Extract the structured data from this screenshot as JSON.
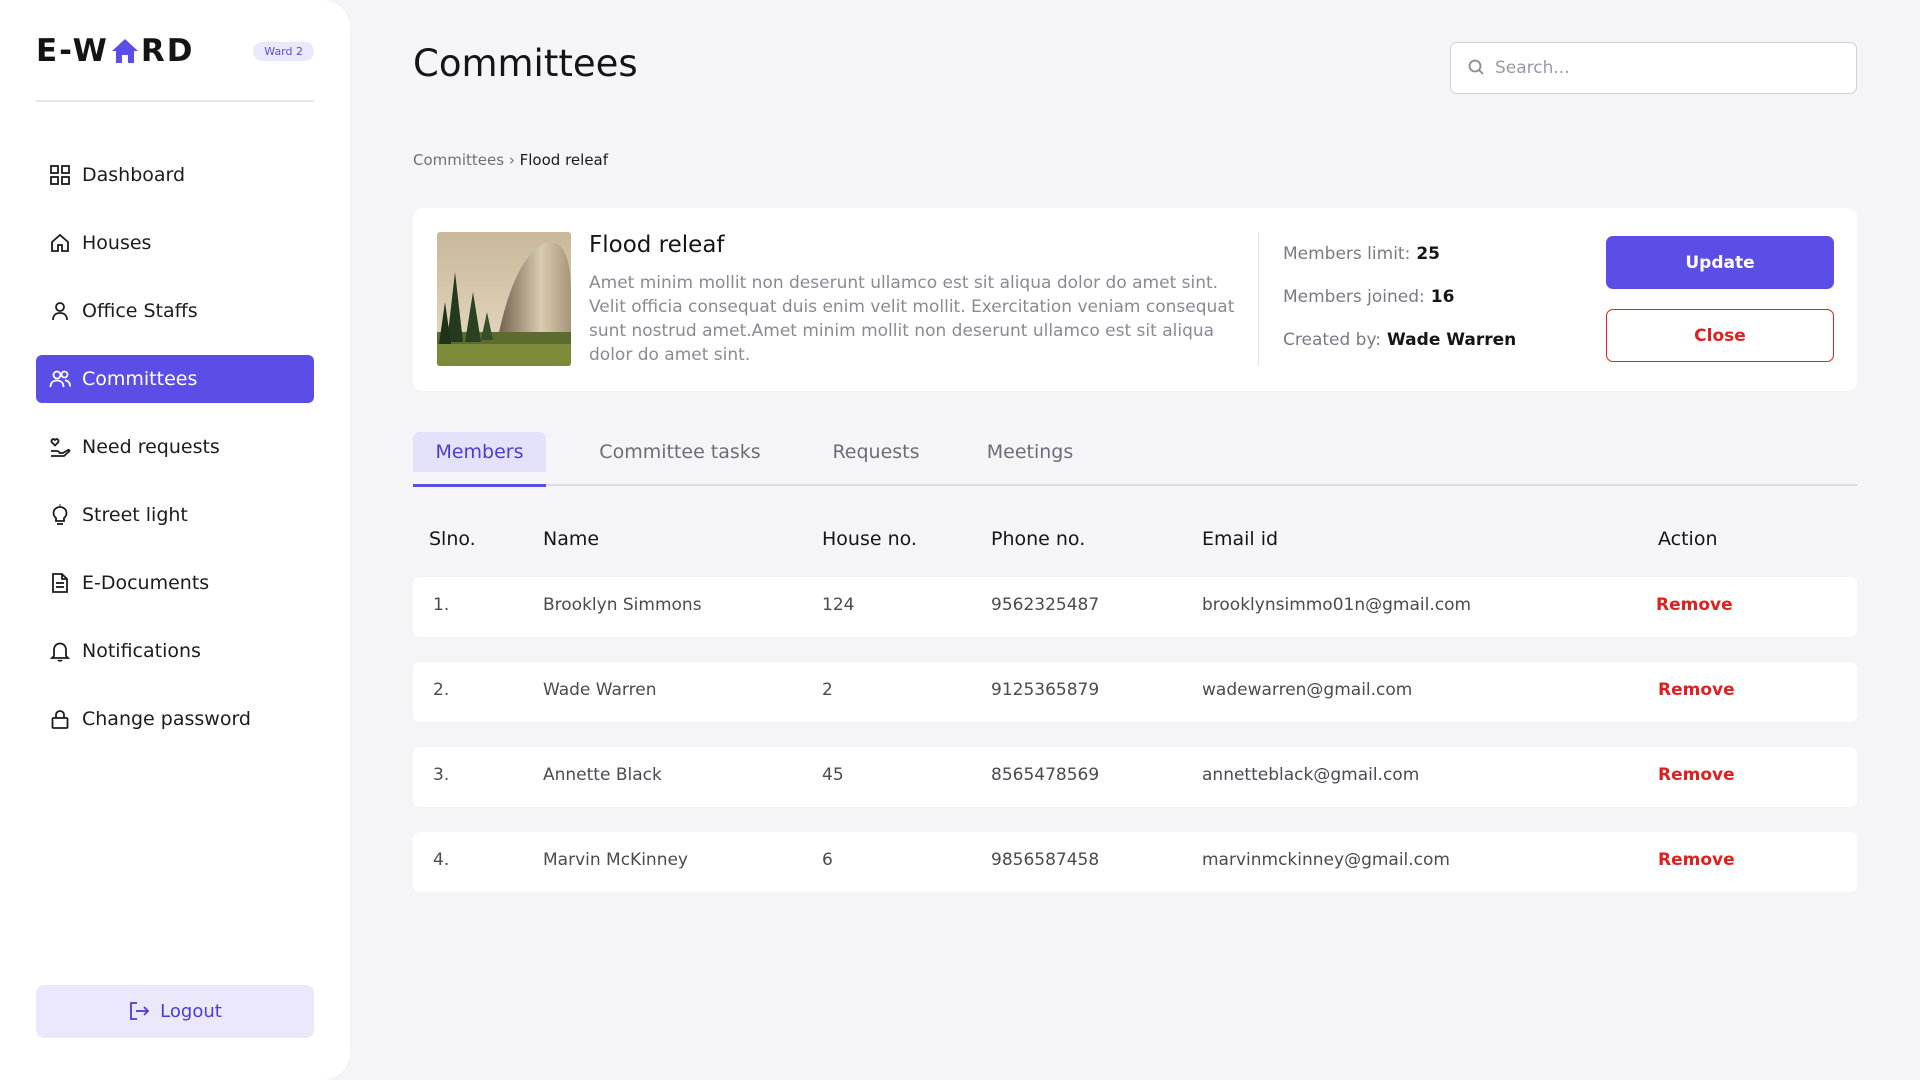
{
  "brand": {
    "logo_left": "E-W",
    "logo_right": "RD",
    "ward_badge": "Ward 2"
  },
  "colors": {
    "accent": "#5b4ee6",
    "danger": "#e01f1f",
    "accent_light": "#ebe8fc"
  },
  "sidebar": {
    "items": [
      {
        "label": "Dashboard",
        "icon": "grid-icon"
      },
      {
        "label": "Houses",
        "icon": "home-icon"
      },
      {
        "label": "Office Staffs",
        "icon": "user-icon"
      },
      {
        "label": "Committees",
        "icon": "users-icon",
        "active": true
      },
      {
        "label": "Need requests",
        "icon": "hand-heart-icon"
      },
      {
        "label": "Street light",
        "icon": "bulb-icon"
      },
      {
        "label": "E-Documents",
        "icon": "document-icon"
      },
      {
        "label": "Notifications",
        "icon": "bell-icon"
      },
      {
        "label": "Change password",
        "icon": "lock-icon"
      }
    ],
    "logout_label": "Logout"
  },
  "header": {
    "title": "Committees",
    "search_placeholder": "Search..."
  },
  "breadcrumb": {
    "parent": "Committees",
    "separator": "›",
    "current": "Flood releaf"
  },
  "committee": {
    "title": "Flood releaf",
    "description": "Amet minim mollit non deserunt ullamco est sit aliqua dolor do amet sint. Velit officia consequat duis enim velit mollit. Exercitation veniam consequat sunt nostrud amet.Amet minim mollit non deserunt ullamco est sit aliqua dolor do amet sint.",
    "members_limit_label": "Members limit:",
    "members_limit": "25",
    "members_joined_label": "Members joined:",
    "members_joined": "16",
    "created_by_label": "Created by:",
    "created_by": "Wade Warren",
    "update_label": "Update",
    "close_label": "Close"
  },
  "tabs": [
    "Members",
    "Committee tasks",
    "Requests",
    "Meetings"
  ],
  "table": {
    "headers": [
      "Slno.",
      "Name",
      "House no.",
      "Phone no.",
      "Email id",
      "Action"
    ],
    "rows": [
      {
        "slno": "1.",
        "name": "Brooklyn Simmons",
        "house": "124",
        "phone": "9562325487",
        "email": "brooklynsimmo01n@gmail.com",
        "action": "Remove"
      },
      {
        "slno": "2.",
        "name": "Wade Warren",
        "house": "2",
        "phone": "9125365879",
        "email": "wadewarren@gmail.com",
        "action": "Remove"
      },
      {
        "slno": "3.",
        "name": "Annette Black",
        "house": "45",
        "phone": "8565478569",
        "email": "annetteblack@gmail.com",
        "action": "Remove"
      },
      {
        "slno": "4.",
        "name": "Marvin McKinney",
        "house": "6",
        "phone": "9856587458",
        "email": "marvinmckinney@gmail.com",
        "action": "Remove"
      }
    ]
  }
}
